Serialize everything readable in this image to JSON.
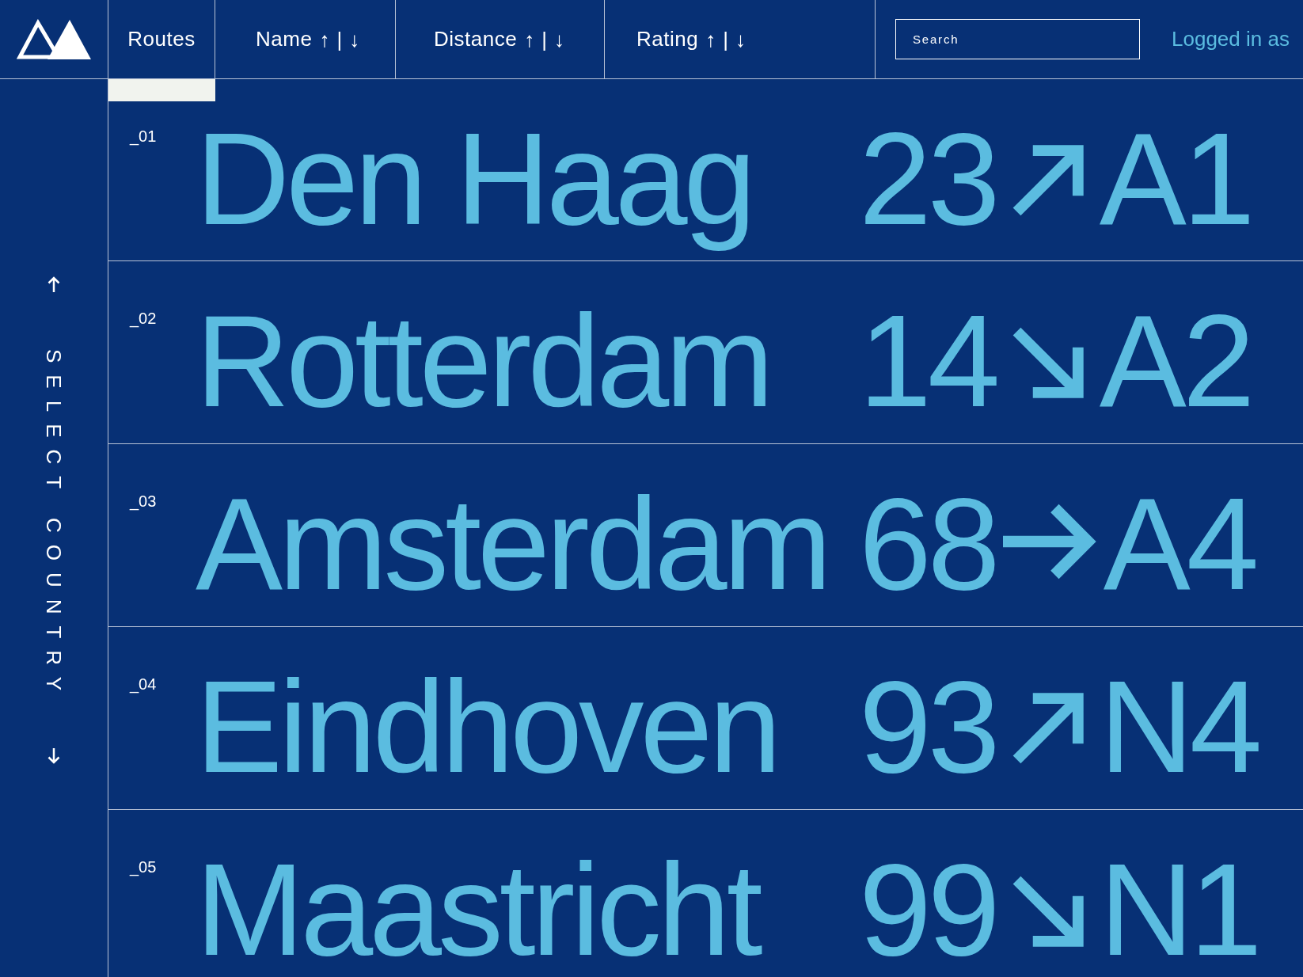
{
  "header": {
    "tab": {
      "label": "Routes",
      "selected": true
    },
    "sort_columns": [
      {
        "label": "Name",
        "ascending": "↑",
        "divider": "|",
        "descending": "↓"
      },
      {
        "label": "Distance",
        "ascending": "↑",
        "divider": "|",
        "descending": "↓"
      },
      {
        "label": "Rating",
        "ascending": "↑",
        "divider": "|",
        "descending": "↓"
      }
    ],
    "search": {
      "placeholder": "Search"
    },
    "user_label": "Logged in as"
  },
  "sidebar": {
    "label": "SELECT COUNTRY"
  },
  "routes": [
    {
      "number": "_01",
      "name": "Den Haag",
      "distance": "23",
      "kind": "up",
      "road": "A1"
    },
    {
      "number": "_02",
      "name": "Rotterdam",
      "distance": "14",
      "kind": "down",
      "road": "A2"
    },
    {
      "number": "_03",
      "name": "Amsterdam",
      "distance": "68",
      "kind": "flat",
      "road": "A4"
    },
    {
      "number": "_04",
      "name": "Eindhoven",
      "distance": "93",
      "kind": "up",
      "road": "N4"
    },
    {
      "number": "_05",
      "name": "Maastricht",
      "distance": "99",
      "kind": "down",
      "road": "N1"
    }
  ]
}
